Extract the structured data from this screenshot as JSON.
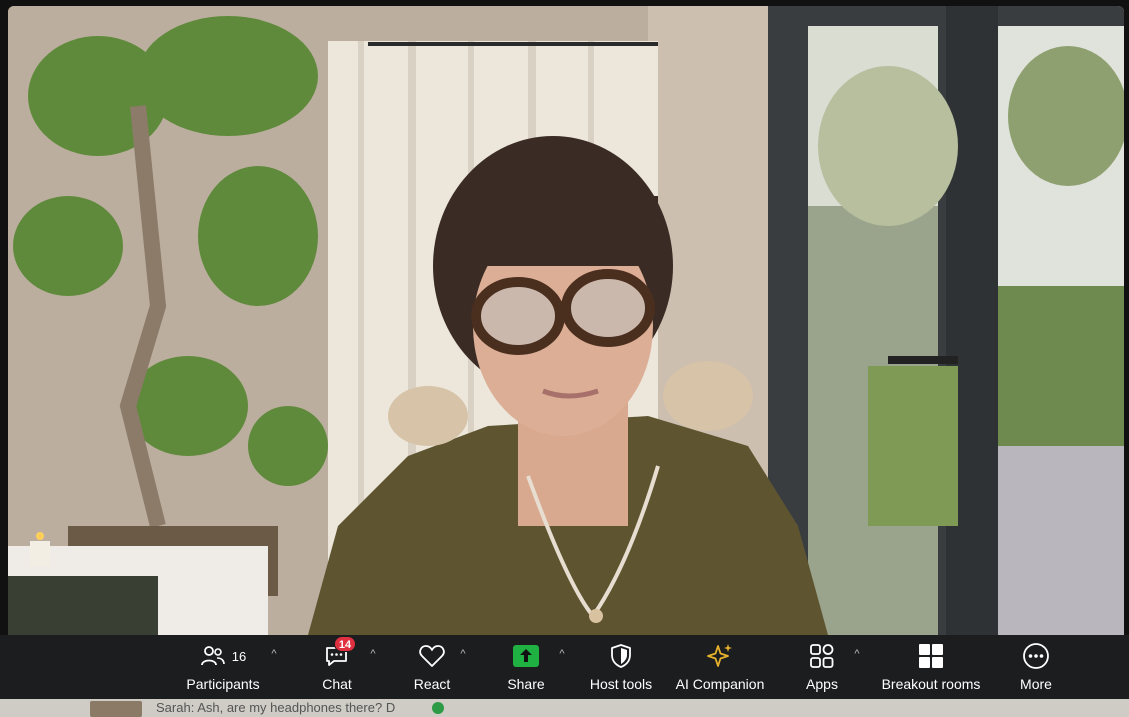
{
  "toolbar": {
    "participants": {
      "label": "Participants",
      "count": "16"
    },
    "chat": {
      "label": "Chat",
      "badge": "14"
    },
    "react": {
      "label": "React"
    },
    "share": {
      "label": "Share"
    },
    "host_tools": {
      "label": "Host tools"
    },
    "ai_companion": {
      "label": "AI Companion"
    },
    "apps": {
      "label": "Apps"
    },
    "breakout_rooms": {
      "label": "Breakout rooms"
    },
    "more": {
      "label": "More"
    },
    "caret": "^"
  },
  "chat_preview": {
    "message": "Sarah: Ash, are my headphones there? D"
  },
  "colors": {
    "toolbar_bg": "#1c1d1f",
    "share_green": "#1fb141",
    "badge_red": "#e02f3f",
    "ai_gold": "#e8b12c"
  },
  "icons": [
    "participants-icon",
    "chat-icon",
    "heart-icon",
    "share-arrow-icon",
    "shield-icon",
    "sparkle-icon",
    "apps-icon",
    "grid-icon",
    "more-dots-icon"
  ]
}
